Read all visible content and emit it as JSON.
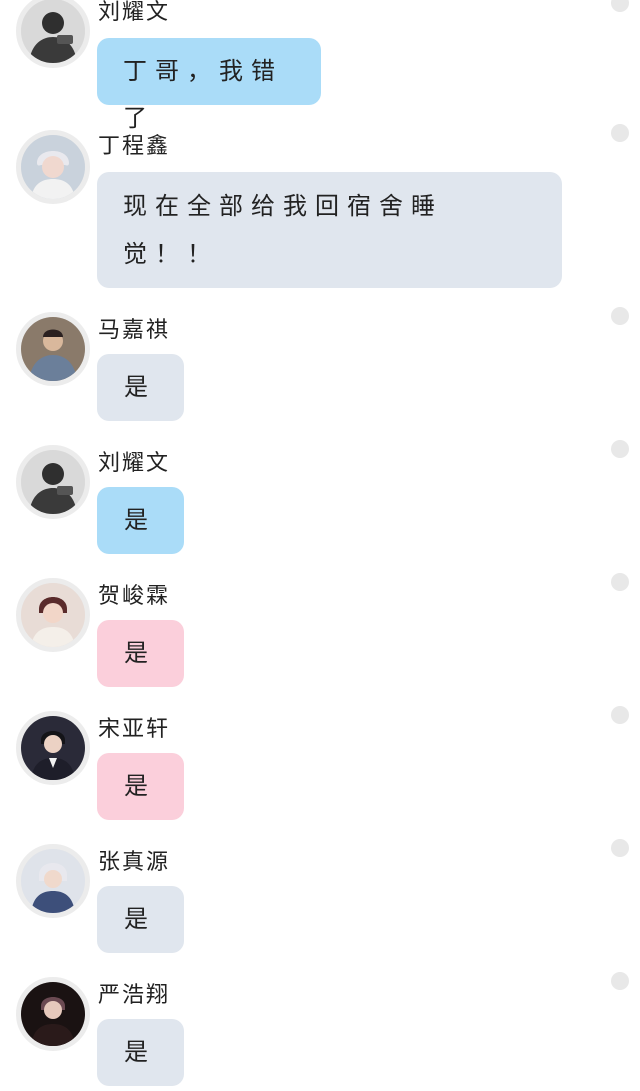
{
  "messages": [
    {
      "sender": "刘耀文",
      "text": "丁哥，我错了",
      "bubble": "blue",
      "avatar_icon": "person-photo-icon",
      "avatar_color": "#3a3a3a"
    },
    {
      "sender": "丁程鑫",
      "text": "现在全部给我回宿舍睡觉！！",
      "bubble": "grey",
      "avatar_icon": "person-photo-icon",
      "avatar_color": "#c9d2dc"
    },
    {
      "sender": "马嘉祺",
      "text": "是",
      "bubble": "grey",
      "avatar_icon": "person-photo-icon",
      "avatar_color": "#6b5544"
    },
    {
      "sender": "刘耀文",
      "text": "是",
      "bubble": "blue",
      "avatar_icon": "person-photo-icon",
      "avatar_color": "#3a3a3a"
    },
    {
      "sender": "贺峻霖",
      "text": "是",
      "bubble": "pink",
      "avatar_icon": "person-photo-icon",
      "avatar_color": "#5a2b2b"
    },
    {
      "sender": "宋亚轩",
      "text": "是",
      "bubble": "pink",
      "avatar_icon": "person-photo-icon",
      "avatar_color": "#1e1e2a"
    },
    {
      "sender": "张真源",
      "text": "是",
      "bubble": "grey",
      "avatar_icon": "person-photo-icon",
      "avatar_color": "#3d4f7a"
    },
    {
      "sender": "严浩翔",
      "text": "是",
      "bubble": "grey",
      "avatar_icon": "person-photo-icon",
      "avatar_color": "#2a1a1a"
    }
  ],
  "colors": {
    "bubble_blue": "#aadcf8",
    "bubble_grey": "#e0e6ee",
    "bubble_pink": "#fbcfdb",
    "status_dot": "#e8e8e8"
  }
}
